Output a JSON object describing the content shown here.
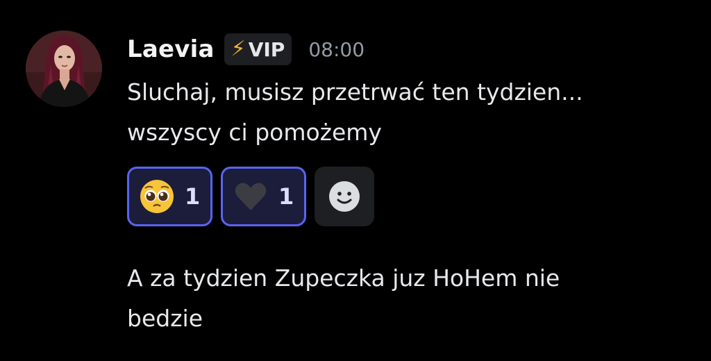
{
  "message1": {
    "author": "Laevia",
    "badge": {
      "icon": "lightning-icon",
      "label": "VIP",
      "color": "#f0b232"
    },
    "timestamp": "08:00",
    "lines": [
      "Sluchaj, musisz przetrwać ten tydzien...",
      "wszyscy ci pomożemy"
    ],
    "reactions": [
      {
        "emoji": "pleading-face-icon",
        "count": "1"
      },
      {
        "emoji": "black-heart-icon",
        "count": "1"
      }
    ],
    "add_reaction_icon": "smiley-add-icon"
  },
  "message2": {
    "lines": [
      "A za tydzien Zupeczka juz HoHem nie",
      "bedzie"
    ]
  },
  "colors": {
    "background": "#000000",
    "reaction_border": "#5865f2",
    "reaction_bg": "#1c1d3a",
    "timestamp": "#949ba4"
  }
}
